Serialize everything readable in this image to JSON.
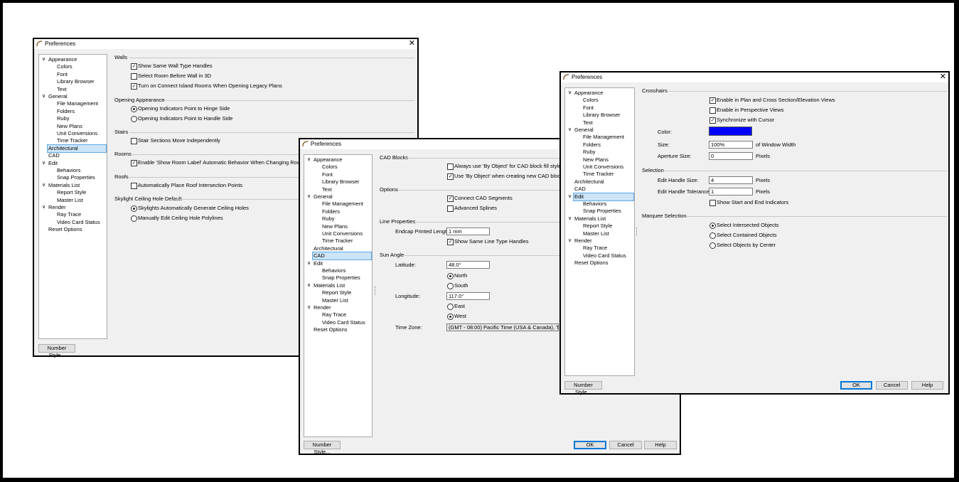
{
  "dialogs": [
    {
      "title": "Preferences",
      "tree": [
        {
          "label": "Appearance",
          "chev": "∨"
        },
        {
          "label": "Colors"
        },
        {
          "label": "Font"
        },
        {
          "label": "Library Browser"
        },
        {
          "label": "Text"
        },
        {
          "label": "General",
          "chev": "∨"
        },
        {
          "label": "File Management"
        },
        {
          "label": "Folders"
        },
        {
          "label": "Ruby"
        },
        {
          "label": "New Plans"
        },
        {
          "label": "Unit Conversions"
        },
        {
          "label": "Time Tracker"
        },
        {
          "label": "Architectural",
          "selected": true
        },
        {
          "label": "CAD"
        },
        {
          "label": "Edit",
          "chev": "∨"
        },
        {
          "label": "Behaviors"
        },
        {
          "label": "Snap Properties"
        },
        {
          "label": "Materials List",
          "chev": "∨"
        },
        {
          "label": "Report Style"
        },
        {
          "label": "Master List"
        },
        {
          "label": "Render",
          "chev": "∨"
        },
        {
          "label": "Ray Trace"
        },
        {
          "label": "Video Card Status"
        },
        {
          "label": "Reset Options"
        }
      ],
      "panel": {
        "walls": {
          "title": "Walls",
          "items": [
            {
              "label": "Show Same Wall Type Handles",
              "checked": true
            },
            {
              "label": "Select Room Before Wall in 3D",
              "checked": false
            },
            {
              "label": "Turn on Connect Island Rooms When Opening Legacy Plans",
              "checked": true
            }
          ]
        },
        "opening": {
          "title": "Opening Appearance",
          "items": [
            {
              "label": "Opening Indicators Point to Hinge Side",
              "selected": true
            },
            {
              "label": "Opening Indicators Point to Handle Side",
              "selected": false
            }
          ]
        },
        "stairs": {
          "title": "Stairs",
          "item": {
            "label": "Stair Sections Move Independently",
            "checked": false
          }
        },
        "rooms": {
          "title": "Rooms",
          "item": {
            "label": "Enable 'Show Room Label' Automatic Behavior When Changing Room Types",
            "checked": true
          }
        },
        "roofs": {
          "title": "Roofs",
          "item": {
            "label": "Automatically Place Roof Intersection Points",
            "checked": false
          }
        },
        "skylight": {
          "title": "Skylight Ceiling Hole Default",
          "items": [
            {
              "label": "Skylights Automatically Generate Ceiling Holes",
              "selected": true
            },
            {
              "label": "Manually Edit Ceiling Hole Polylines",
              "selected": false
            }
          ]
        }
      },
      "number_style": "Number Style..."
    },
    {
      "title": "Preferences",
      "tree": [
        {
          "label": "Appearance",
          "chev": "∨"
        },
        {
          "label": "Colors"
        },
        {
          "label": "Font"
        },
        {
          "label": "Library Browser"
        },
        {
          "label": "Text"
        },
        {
          "label": "General",
          "chev": "∨"
        },
        {
          "label": "File Management"
        },
        {
          "label": "Folders"
        },
        {
          "label": "Ruby"
        },
        {
          "label": "New Plans"
        },
        {
          "label": "Unit Conversions"
        },
        {
          "label": "Time Tracker"
        },
        {
          "label": "Architectural"
        },
        {
          "label": "CAD",
          "selected": true
        },
        {
          "label": "Edit",
          "chev": "∨"
        },
        {
          "label": "Behaviors"
        },
        {
          "label": "Snap Properties"
        },
        {
          "label": "Materials List",
          "chev": "∨"
        },
        {
          "label": "Report Style"
        },
        {
          "label": "Master List"
        },
        {
          "label": "Render",
          "chev": "∨"
        },
        {
          "label": "Ray Trace"
        },
        {
          "label": "Video Card Status"
        },
        {
          "label": "Reset Options"
        }
      ],
      "panel": {
        "cad_blocks": {
          "title": "CAD Blocks",
          "items": [
            {
              "label": "Always use 'By Object' for CAD block fill style",
              "checked": false
            },
            {
              "label": "Use 'By Object' when creating new CAD blocks",
              "checked": true
            }
          ]
        },
        "options": {
          "title": "Options",
          "items": [
            {
              "label": "Connect CAD Segments",
              "checked": true
            },
            {
              "label": "Advanced Splines",
              "checked": false
            }
          ]
        },
        "line_props": {
          "title": "Line Properties",
          "endcap_label": "Endcap Printed Length:",
          "endcap_value": "1 mm",
          "item": {
            "label": "Show Same Line Type Handles",
            "checked": true
          }
        },
        "sun": {
          "title": "Sun Angle",
          "latitude_label": "Latitude:",
          "latitude_value": "48.0°",
          "lat_options": [
            {
              "label": "North",
              "selected": true
            },
            {
              "label": "South",
              "selected": false
            }
          ],
          "longitude_label": "Longitude:",
          "longitude_value": "117.0°",
          "lon_options": [
            {
              "label": "East",
              "selected": false
            },
            {
              "label": "West",
              "selected": true
            }
          ],
          "tz_label": "Time Zone:",
          "tz_value": "(GMT - 08:00) Pacific Time (USA & Canada), Tijuana"
        }
      },
      "number_style": "Number Style...",
      "ok": "OK",
      "cancel": "Cancel",
      "help": "Help"
    },
    {
      "title": "Preferences",
      "tree": [
        {
          "label": "Appearance",
          "chev": "∨"
        },
        {
          "label": "Colors"
        },
        {
          "label": "Font"
        },
        {
          "label": "Library Browser"
        },
        {
          "label": "Text"
        },
        {
          "label": "General",
          "chev": "∨"
        },
        {
          "label": "File Management"
        },
        {
          "label": "Folders"
        },
        {
          "label": "Ruby"
        },
        {
          "label": "New Plans"
        },
        {
          "label": "Unit Conversions"
        },
        {
          "label": "Time Tracker"
        },
        {
          "label": "Architectural"
        },
        {
          "label": "CAD"
        },
        {
          "label": "Edit",
          "chev": "∨",
          "selected": true
        },
        {
          "label": "Behaviors"
        },
        {
          "label": "Snap Properties"
        },
        {
          "label": "Materials List",
          "chev": "∨"
        },
        {
          "label": "Report Style"
        },
        {
          "label": "Master List"
        },
        {
          "label": "Render",
          "chev": "∨"
        },
        {
          "label": "Ray Trace"
        },
        {
          "label": "Video Card Status"
        },
        {
          "label": "Reset Options"
        }
      ],
      "panel": {
        "crosshairs": {
          "title": "Crosshairs",
          "items": [
            {
              "label": "Enable in Plan and Cross Section/Elevation Views",
              "checked": true
            },
            {
              "label": "Enable in Perspective Views",
              "checked": false
            },
            {
              "label": "Synchronize with Cursor",
              "checked": true
            }
          ],
          "color_label": "Color:",
          "color_value": "#0000ff",
          "size_label": "Size:",
          "size_value": "100%",
          "size_unit": "of Window Width",
          "aperture_label": "Aperture Size:",
          "aperture_value": "0",
          "aperture_unit": "Pixels"
        },
        "selection": {
          "title": "Selection",
          "handle_size_label": "Edit Handle Size:",
          "handle_size_value": "4",
          "handle_size_unit": "Pixels",
          "handle_tol_label": "Edit Handle Tolerance:",
          "handle_tol_value": "1",
          "handle_tol_unit": "Pixels",
          "item": {
            "label": "Show Start and End Indicators",
            "checked": false
          }
        },
        "marquee": {
          "title": "Marquee Selection",
          "items": [
            {
              "label": "Select Intersected Objects",
              "selected": true
            },
            {
              "label": "Select Contained Objects",
              "selected": false
            },
            {
              "label": "Select Objects by Center",
              "selected": false
            }
          ]
        }
      },
      "number_style": "Number Style...",
      "ok": "OK",
      "cancel": "Cancel",
      "help": "Help"
    }
  ]
}
